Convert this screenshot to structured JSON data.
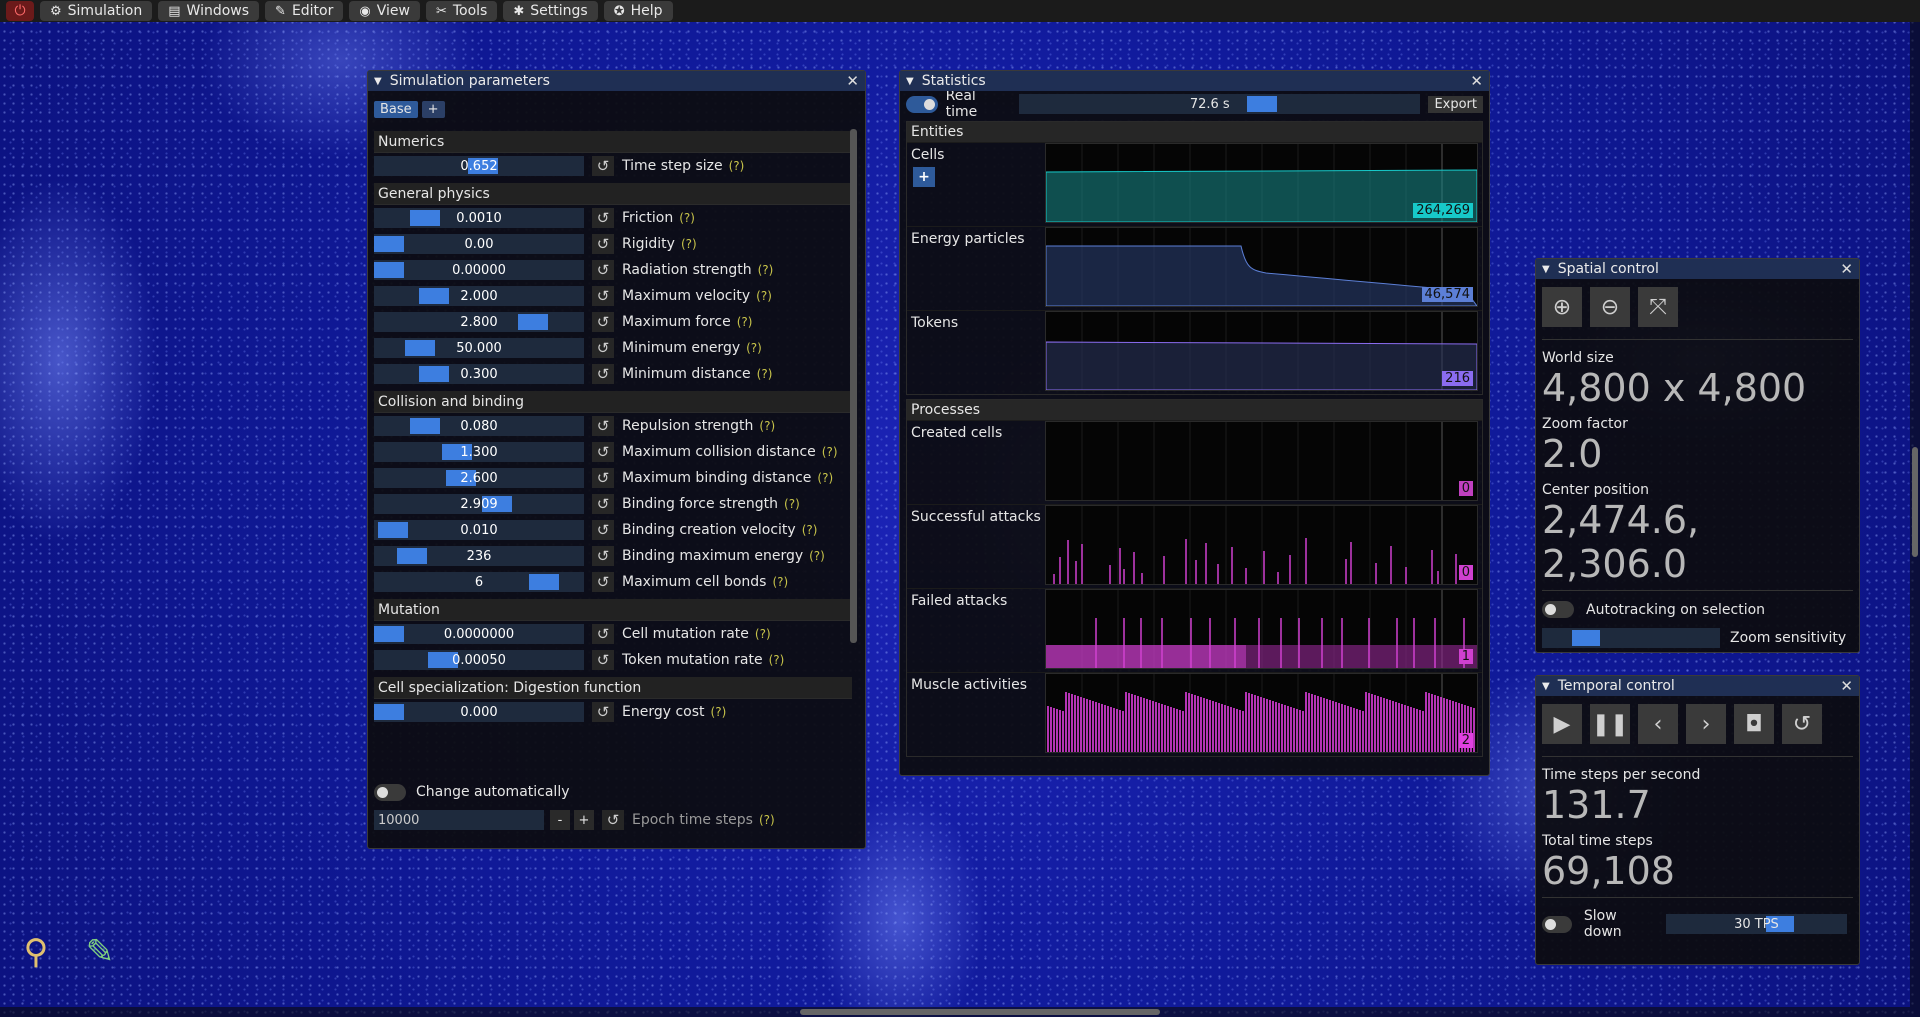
{
  "menu": {
    "items": [
      {
        "label": "Simulation",
        "icon": "joystick-icon",
        "glyph": "⚙"
      },
      {
        "label": "Windows",
        "icon": "windows-icon",
        "glyph": "▤"
      },
      {
        "label": "Editor",
        "icon": "pencil-icon",
        "glyph": "✎"
      },
      {
        "label": "View",
        "icon": "eye-icon",
        "glyph": "◉"
      },
      {
        "label": "Tools",
        "icon": "tools-icon",
        "glyph": "✂"
      },
      {
        "label": "Settings",
        "icon": "gear-icon",
        "glyph": "✱"
      },
      {
        "label": "Help",
        "icon": "help-icon",
        "glyph": "✪"
      }
    ]
  },
  "simparams": {
    "title": "Simulation parameters",
    "tabs": [
      "Base",
      "+"
    ],
    "help_mark": "(?)",
    "sections": [
      {
        "title": "Numerics",
        "rows": [
          {
            "value": "0.652",
            "label": "Time step size",
            "grab": 0.52
          }
        ]
      },
      {
        "title": "General physics",
        "rows": [
          {
            "value": "0.0010",
            "label": "Friction",
            "grab": 0.2
          },
          {
            "value": "0.00",
            "label": "Rigidity",
            "grab": 0.0
          },
          {
            "value": "0.00000",
            "label": "Radiation strength",
            "grab": 0.0
          },
          {
            "value": "2.000",
            "label": "Maximum velocity",
            "grab": 0.25
          },
          {
            "value": "2.800",
            "label": "Maximum force",
            "grab": 0.8
          },
          {
            "value": "50.000",
            "label": "Minimum energy",
            "grab": 0.17
          },
          {
            "value": "0.300",
            "label": "Minimum distance",
            "grab": 0.25
          }
        ]
      },
      {
        "title": "Collision and binding",
        "rows": [
          {
            "value": "0.080",
            "label": "Repulsion strength",
            "grab": 0.2
          },
          {
            "value": "1.300",
            "label": "Maximum collision distance",
            "grab": 0.38
          },
          {
            "value": "2.600",
            "label": "Maximum binding distance",
            "grab": 0.4
          },
          {
            "value": "2.909",
            "label": "Binding force strength",
            "grab": 0.6
          },
          {
            "value": "0.010",
            "label": "Binding creation velocity",
            "grab": 0.02
          },
          {
            "value": "236",
            "label": "Binding maximum energy",
            "grab": 0.13
          },
          {
            "value": "6",
            "label": "Maximum cell bonds",
            "grab": 0.86
          }
        ]
      },
      {
        "title": "Mutation",
        "rows": [
          {
            "value": "0.0000000",
            "label": "Cell mutation rate",
            "grab": 0.0
          },
          {
            "value": "0.00050",
            "label": "Token mutation rate",
            "grab": 0.3
          }
        ]
      },
      {
        "title": "Cell specialization: Digestion function",
        "rows": [
          {
            "value": "0.000",
            "label": "Energy cost",
            "grab": 0.0
          }
        ]
      }
    ],
    "change_auto_label": "Change automatically",
    "epoch_value": "10000",
    "epoch_minus": "-",
    "epoch_plus": "+",
    "epoch_label": "Epoch time steps"
  },
  "stats": {
    "title": "Statistics",
    "realtime_label": "Real time",
    "realtime_value": "72.6 s",
    "export_label": "Export",
    "entities": {
      "title": "Entities",
      "rows": [
        {
          "label": "Cells",
          "value": "264,269",
          "color": "#17c9c9",
          "kind": "cells"
        },
        {
          "label": "Energy particles",
          "value": "46,574",
          "color": "#5c7fd6",
          "kind": "energy"
        },
        {
          "label": "Tokens",
          "value": "216",
          "color": "#8a6cf0",
          "kind": "tokens"
        }
      ]
    },
    "processes": {
      "title": "Processes",
      "rows": [
        {
          "label": "Created cells",
          "value": "0",
          "color": "#c040c0",
          "kind": "empty"
        },
        {
          "label": "Successful attacks",
          "value": "0",
          "color": "#d040d0",
          "kind": "sparse"
        },
        {
          "label": "Failed attacks",
          "value": "1",
          "color": "#d040d0",
          "kind": "dense"
        },
        {
          "label": "Muscle activities",
          "value": "2",
          "color": "#e040e0",
          "kind": "full"
        }
      ]
    }
  },
  "spatial": {
    "title": "Spatial control",
    "world_size_label": "World size",
    "world_size": "4,800 x 4,800",
    "zoom_label": "Zoom factor",
    "zoom": "2.0",
    "center_label": "Center position",
    "center": "2,474.6, 2,306.0",
    "autotrack_label": "Autotracking on selection",
    "zoom_sens_label": "Zoom sensitivity"
  },
  "temporal": {
    "title": "Temporal control",
    "tps_label": "Time steps per second",
    "tps": "131.7",
    "total_label": "Total time steps",
    "total": "69,108",
    "slowdown_label": "Slow down",
    "slowdown_value": "30",
    "slowdown_unit": "TPS"
  },
  "colors": {
    "accent": "#3d7ee0",
    "title_bar": "#1f2f54",
    "plot_magenta": "#d040d0"
  }
}
